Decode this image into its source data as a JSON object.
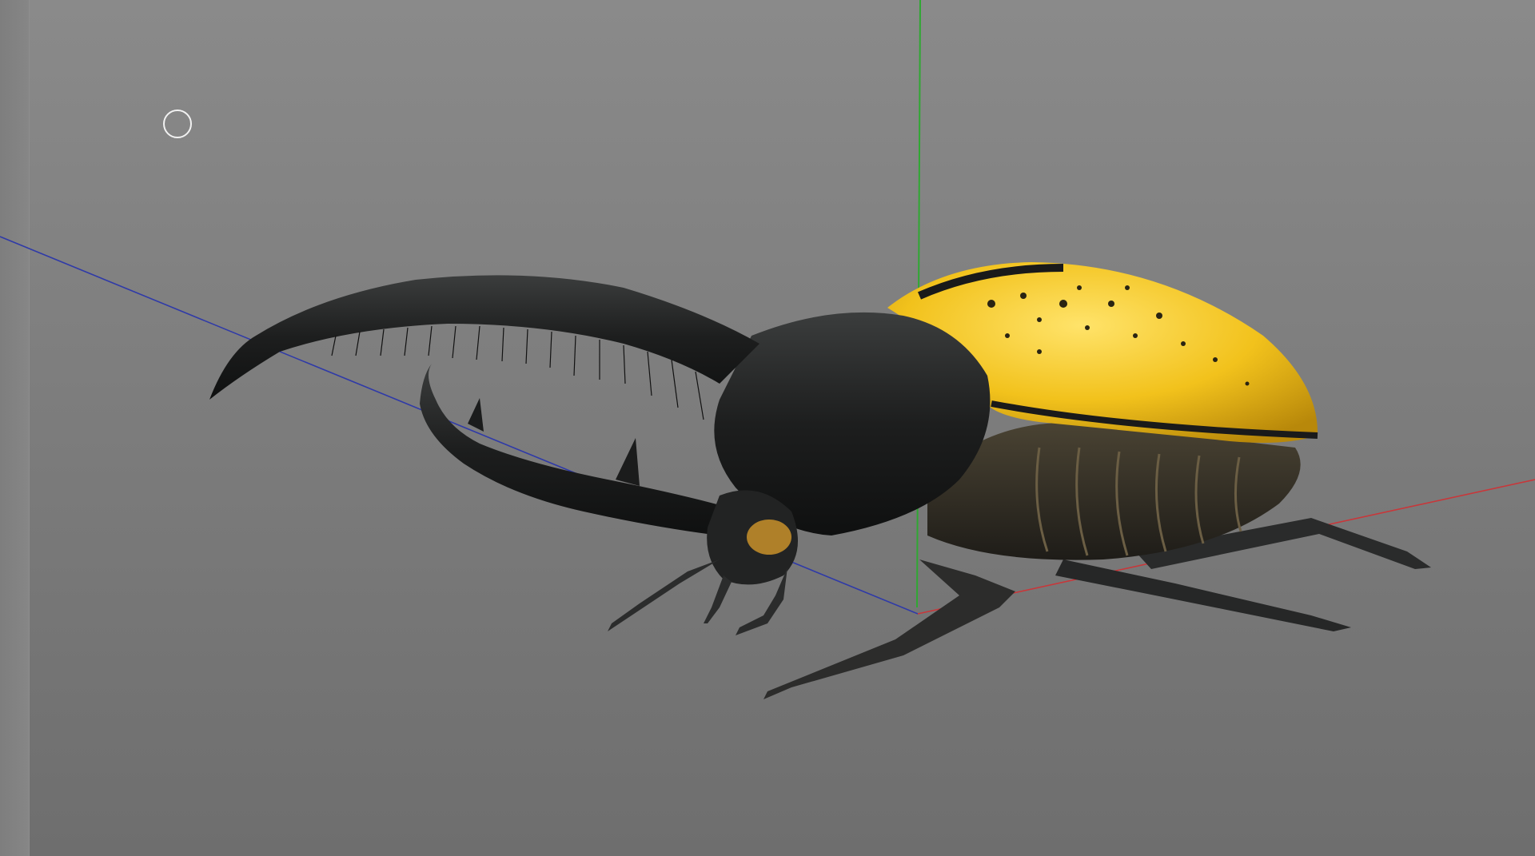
{
  "viewport": {
    "background_top": "#8a8a8a",
    "background_bottom": "#6e6e6e",
    "axes": {
      "x_axis_color": "#c8373a",
      "y_axis_color": "#2fa832",
      "z_axis_color": "#2f3aa8"
    },
    "light_handle_icon": "circle-icon",
    "model": {
      "subject": "hercules beetle",
      "elytra_color": "#f0c020",
      "body_color": "#1e1f1f",
      "highlight_color": "#c8902a"
    }
  }
}
